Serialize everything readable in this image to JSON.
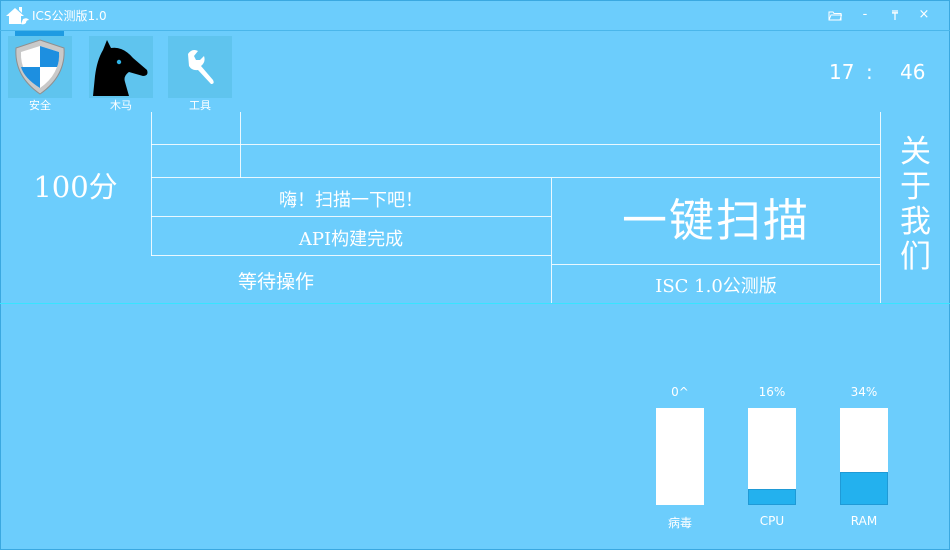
{
  "window": {
    "title": "ICS公测版1.0"
  },
  "toolbar": {
    "items": [
      {
        "label": "安全",
        "icon": "shield-icon"
      },
      {
        "label": "木马",
        "icon": "horse-icon"
      },
      {
        "label": "工具",
        "icon": "wrench-icon"
      }
    ]
  },
  "clock": {
    "hour": "17",
    "sep": ":",
    "minute": "46"
  },
  "panel": {
    "score": "100分",
    "greeting": "嗨！扫描一下吧！",
    "api_status": "API构建完成",
    "wait": "等待操作",
    "scan_button": "一键扫描",
    "version": "ISC 1.0公测版",
    "about_lines": [
      "关",
      "于",
      "我",
      "们"
    ]
  },
  "gauges": [
    {
      "label": "病毒",
      "value_text": "0^",
      "fraction": 0.0
    },
    {
      "label": "CPU",
      "value_text": "16%",
      "fraction": 0.16
    },
    {
      "label": "RAM",
      "value_text": "34%",
      "fraction": 0.34
    }
  ],
  "colors": {
    "background": "#6ccdfc",
    "accent": "#23b1ee",
    "divider": "#38e4ff"
  }
}
